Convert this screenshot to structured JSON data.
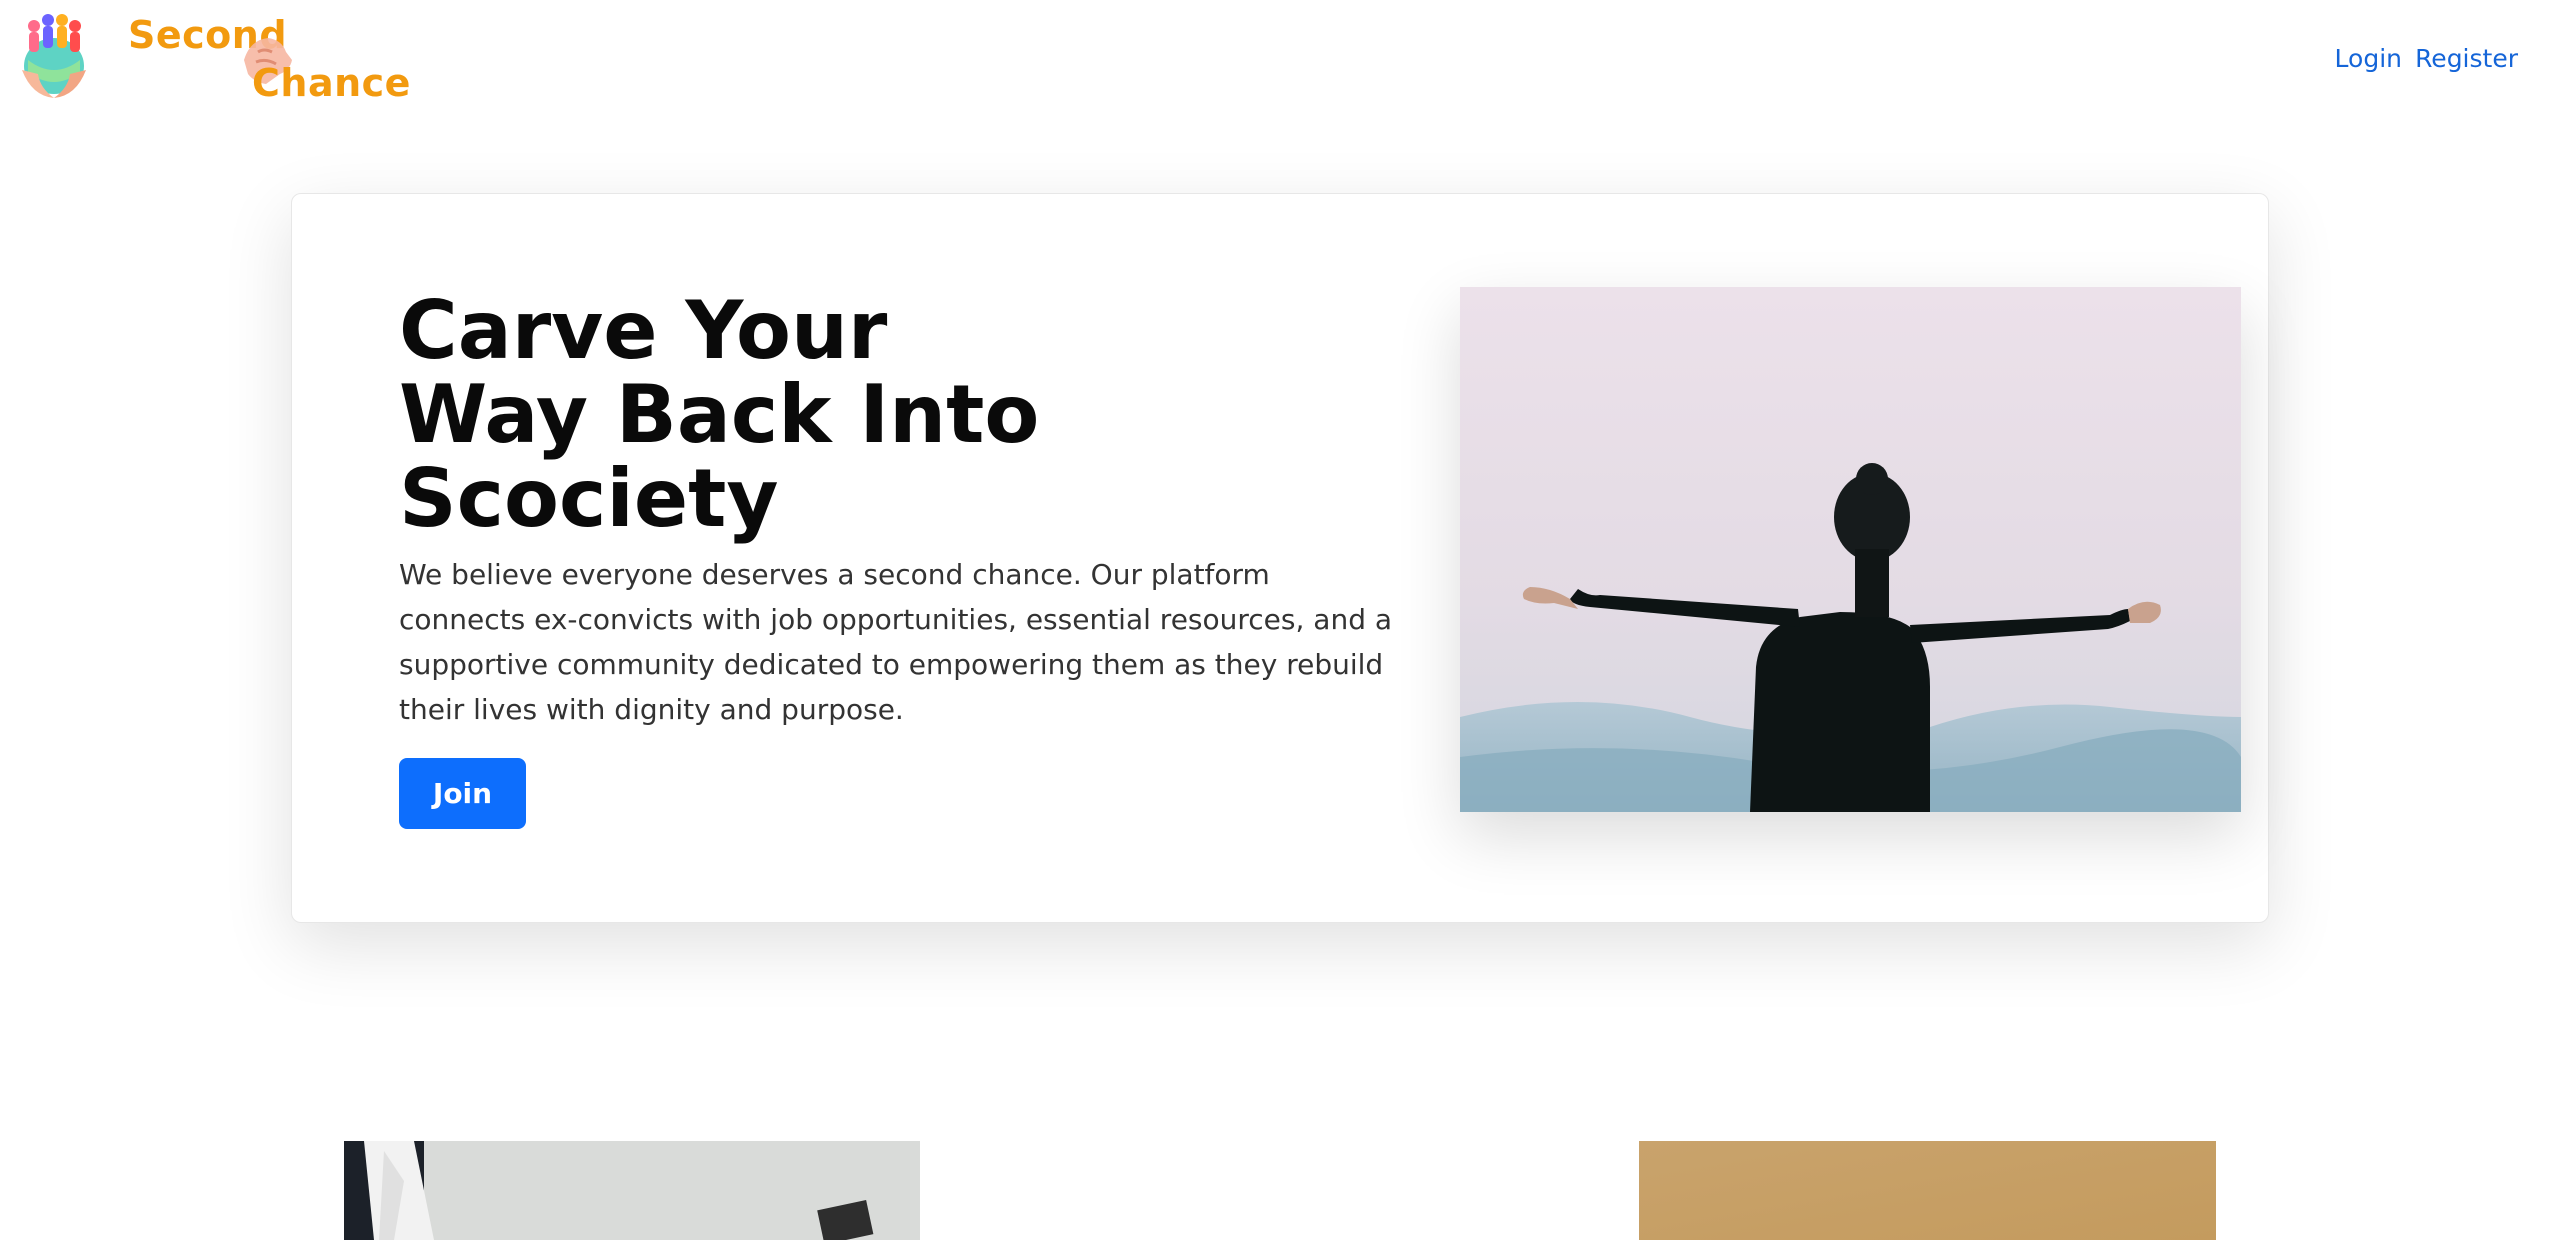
{
  "header": {
    "brand_line1": "Second",
    "brand_line2": "Chance",
    "brand_color": "#f29a0f",
    "nav": {
      "login_label": "Login",
      "register_label": "Register"
    },
    "link_color": "#1565d8"
  },
  "hero": {
    "title_line1": "Carve Your",
    "title_line2": "Way Back Into",
    "title_line3": "Scociety",
    "description": "We believe everyone deserves a second chance. Our platform connects ex-convicts with job opportunities, essential resources, and a supportive community dedicated to empowering them as they rebuild their lives with dignity and purpose.",
    "join_label": "Join",
    "button_color": "#0d6efd"
  },
  "icons": {
    "logo": "people-globe-hands-icon",
    "brand_hand": "helping-hand-icon"
  },
  "images": {
    "hero": "man-arms-outstretched-photo",
    "left_card": "office-person-photo",
    "right_card": "gold-texture-photo"
  }
}
